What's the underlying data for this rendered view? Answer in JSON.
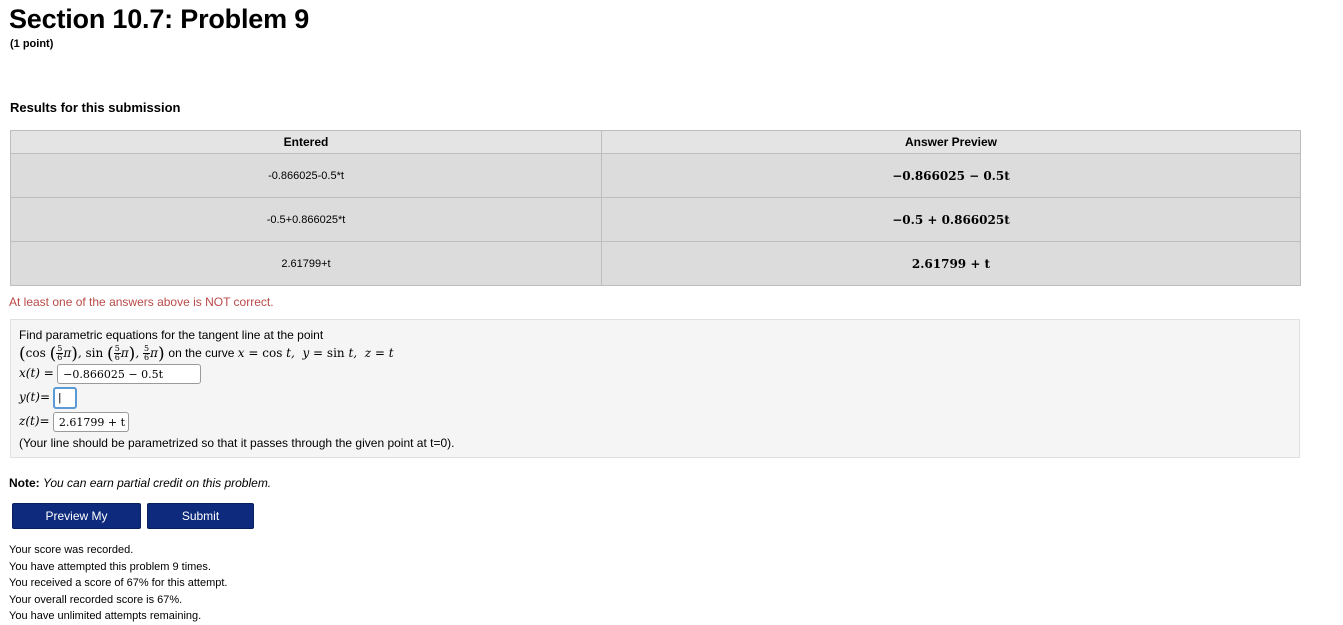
{
  "header": {
    "title": "Section 10.7: Problem 9",
    "points": "(1 point)"
  },
  "results": {
    "heading": "Results for this submission",
    "columns": [
      "Entered",
      "Answer Preview"
    ],
    "rows": [
      {
        "entered": "-0.866025-0.5*t",
        "preview": "−0.866025 − 0.5t"
      },
      {
        "entered": "-0.5+0.866025*t",
        "preview": "−0.5 + 0.866025t"
      },
      {
        "entered": "2.61799+t",
        "preview": "2.61799 + t"
      }
    ],
    "status": "At least one of the answers above is NOT correct.",
    "status_color": "#b94a48"
  },
  "problem": {
    "intro": "Find parametric equations for the tangent line at the point",
    "on_curve_text": "on the curve",
    "frac_num": "5",
    "frac_den": "6",
    "x_label": "x(t) =",
    "x_value": "−0.866025 − 0.5t",
    "y_label": "y(t)=",
    "y_value": "|",
    "z_label": "z(t)=",
    "z_value": "2.61799 + t",
    "footnote": "(Your line should be parametrized so that it passes through the given point at t=0)."
  },
  "note": {
    "label": "Note:",
    "text": "You can earn partial credit on this problem."
  },
  "buttons": {
    "preview": "Preview My Answers",
    "submit": "Submit Answers",
    "color": "#0d2a7c"
  },
  "score": {
    "lines": [
      "Your score was recorded.",
      "You have attempted this problem 9 times.",
      "You received a score of 67% for this attempt.",
      "Your overall recorded score is 67%.",
      "You have unlimited attempts remaining."
    ]
  }
}
